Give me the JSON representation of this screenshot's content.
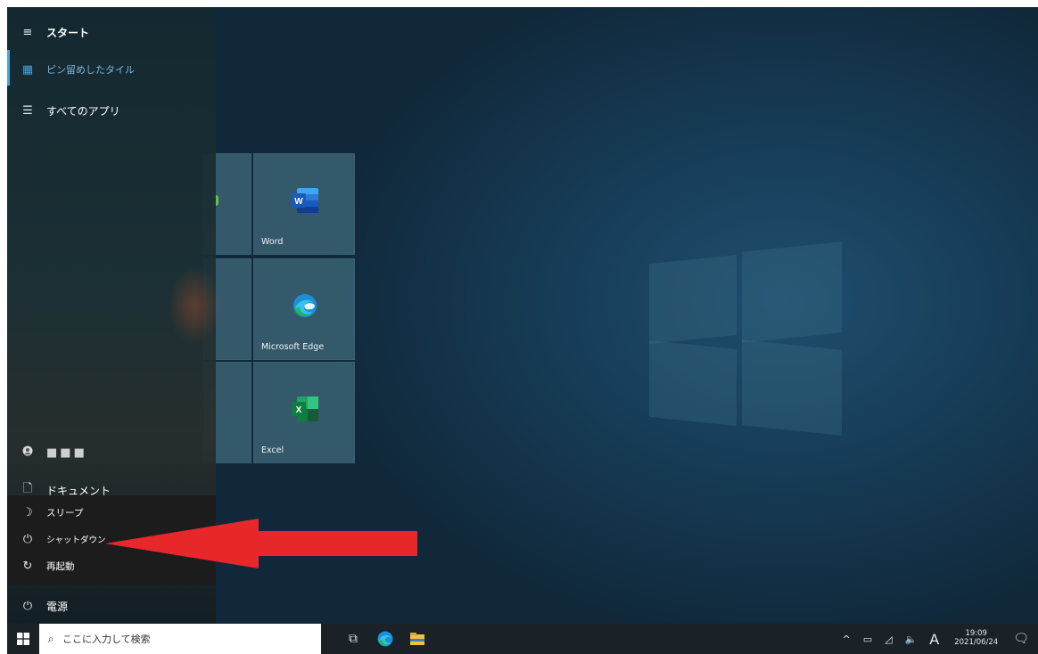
{
  "start_menu": {
    "header": "スタート",
    "nav": [
      {
        "label": "ピン留めしたタイル",
        "icon": "tiles-icon"
      },
      {
        "label": "すべてのアプリ",
        "icon": "list-icon"
      }
    ],
    "user_name": "■■■",
    "documents_label": "ドキュメント",
    "power_menu": [
      {
        "label": "スリープ",
        "icon": "sleep-icon"
      },
      {
        "label": "シャットダウン",
        "icon": "power-icon"
      },
      {
        "label": "再起動",
        "icon": "restart-icon"
      }
    ],
    "power_label": "電源"
  },
  "tiles": [
    {
      "label": "Word",
      "icon": "word-icon",
      "color": "#2b579a"
    },
    {
      "label": "Microsoft Edge",
      "icon": "edge-icon",
      "color": "#1d8fd6"
    },
    {
      "label": "Excel",
      "icon": "excel-icon",
      "color": "#1e7145"
    }
  ],
  "taskbar": {
    "search_placeholder": "ここに入力して検索",
    "ime_indicator": "A",
    "time": "19:09",
    "date": "2021/06/24"
  },
  "colors": {
    "accent": "#4aa3df",
    "arrow": "#e8272a"
  }
}
